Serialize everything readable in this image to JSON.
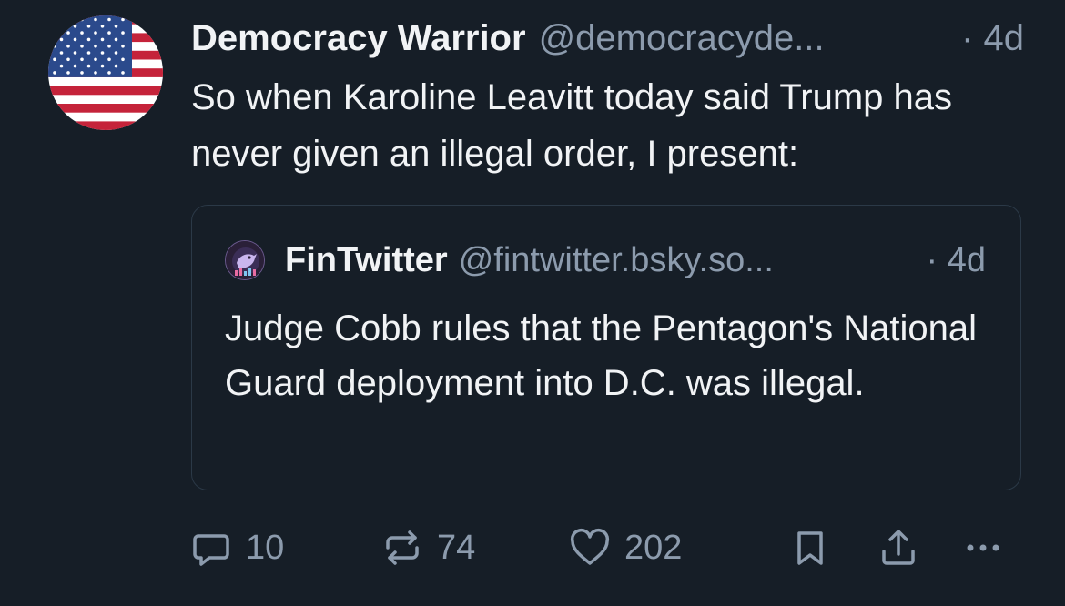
{
  "post": {
    "author_name": "Democracy Warrior",
    "author_handle": "@democracyde...",
    "timestamp": "· 4d",
    "text": "So when Karoline Leavitt today said Trump has never given an illegal order, I present:",
    "avatar_icon": "us-flag-avatar"
  },
  "quote": {
    "author_name": "FinTwitter",
    "author_handle": "@fintwitter.bsky.so...",
    "timestamp": "· 4d",
    "text": "Judge Cobb rules that the Pentagon's National Guard deployment into D.C. was illegal.",
    "avatar_icon": "fintwitter-avatar"
  },
  "actions": {
    "reply_count": "10",
    "repost_count": "74",
    "like_count": "202",
    "reply_icon": "reply-icon",
    "repost_icon": "repost-icon",
    "like_icon": "heart-icon",
    "bookmark_icon": "bookmark-icon",
    "share_icon": "share-icon",
    "more_icon": "more-icon"
  },
  "colors": {
    "background": "#161e27",
    "text_primary": "#f1f3f5",
    "text_secondary": "#8c9bad",
    "border": "#2b3947"
  }
}
